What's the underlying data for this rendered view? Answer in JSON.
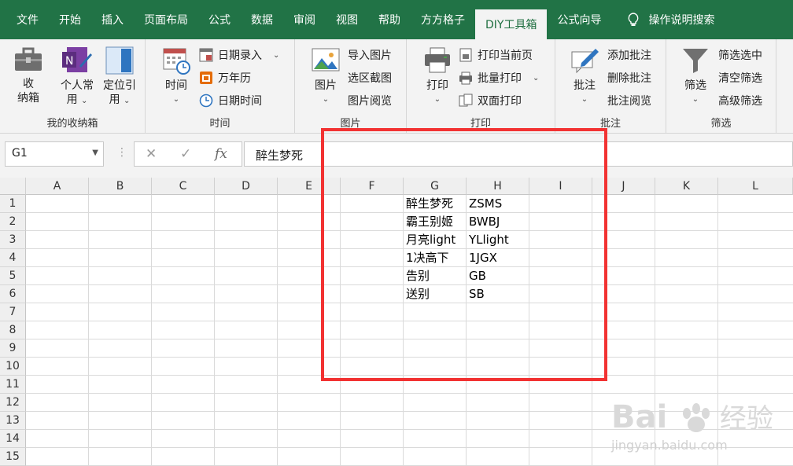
{
  "tabs": [
    "文件",
    "开始",
    "插入",
    "页面布局",
    "公式",
    "数据",
    "审阅",
    "视图",
    "帮助",
    "方方格子",
    "DIY工具箱",
    "公式向导"
  ],
  "active_tab_index": 10,
  "search_label": "操作说明搜索",
  "ribbon": {
    "groups": {
      "collection": {
        "label": "我的收纳箱",
        "btn_collect": "收\n纳箱",
        "btn_personal": "个人常\n用",
        "btn_locate": "定位引\n用"
      },
      "time": {
        "label": "时间",
        "btn_time": "时间",
        "date_entry": "日期录入",
        "calendar": "万年历",
        "datetime": "日期时间"
      },
      "picture": {
        "label": "图片",
        "btn_picture": "图片",
        "import": "导入图片",
        "capture": "选区截图",
        "browse": "图片阅览"
      },
      "print": {
        "label": "打印",
        "btn_print": "打印",
        "current": "打印当前页",
        "batch": "批量打印",
        "duplex": "双面打印"
      },
      "comment": {
        "label": "批注",
        "btn_comment": "批注",
        "add": "添加批注",
        "delete": "删除批注",
        "browse": "批注阅览"
      },
      "filter": {
        "label": "筛选",
        "btn_filter": "筛选",
        "selected": "筛选选中",
        "clear": "清空筛选",
        "advanced": "高级筛选"
      }
    }
  },
  "formula_bar": {
    "name_box": "G1",
    "formula": "醉生梦死",
    "fx": "fx"
  },
  "sheet": {
    "columns": [
      "A",
      "B",
      "C",
      "D",
      "E",
      "F",
      "G",
      "H",
      "I",
      "J",
      "K",
      "L"
    ],
    "rows": [
      "1",
      "2",
      "3",
      "4",
      "5",
      "6",
      "7",
      "8",
      "9",
      "10",
      "11",
      "12",
      "13",
      "14",
      "15"
    ],
    "data": [
      {
        "g": "醉生梦死",
        "h": "ZSMS"
      },
      {
        "g": "霸王别姬",
        "h": "BWBJ"
      },
      {
        "g": "月亮light",
        "h": "YLlight"
      },
      {
        "g": "1决高下",
        "h": "1JGX"
      },
      {
        "g": "告别",
        "h": "GB"
      },
      {
        "g": "送别",
        "h": "SB"
      }
    ]
  },
  "watermark": {
    "line1a": "Bai",
    "line1b": "经验",
    "line2": "jingyan.baidu.com"
  },
  "colors": {
    "excel_green": "#217346",
    "highlight_red": "#f23232"
  }
}
